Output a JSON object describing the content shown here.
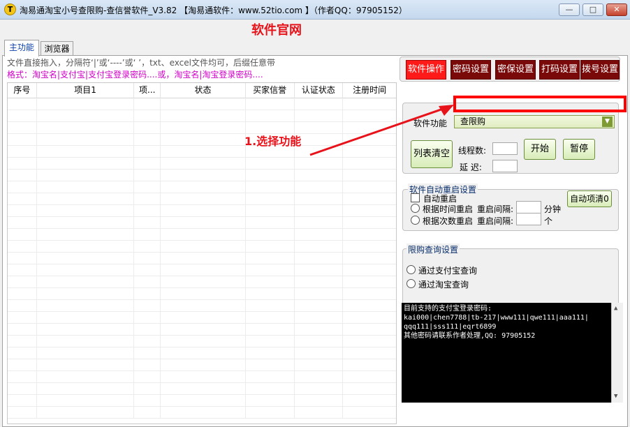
{
  "window": {
    "app_icon": "T",
    "title": "淘易通淘宝小号查限购-查信誉软件_V3.82 【淘易通软件：www.52tio.com 】（作者QQ：97905152）",
    "minimize": "—",
    "maximize": "□",
    "close": "✕"
  },
  "header": {
    "site_link": "软件官网"
  },
  "tabs": [
    {
      "label": "主功能",
      "active": true
    },
    {
      "label": "浏览器",
      "active": false
    }
  ],
  "hints": {
    "line1": "文件直接拖入，分隔符‘|’或‘----’或‘    ’，txt、excel文件均可，后缀任意带",
    "line2": "格式：淘宝名|支付宝|支付宝登录密码....或，淘宝名|淘宝登录密码...."
  },
  "table": {
    "columns": [
      "序号",
      "项目1",
      "项...",
      "状态",
      "买家信誉",
      "认证状态",
      "注册时间"
    ]
  },
  "toolbar": {
    "buttons": [
      {
        "label": "软件操作",
        "active": true
      },
      {
        "label": "密码设置",
        "active": false
      },
      {
        "label": "密保设置",
        "active": false
      },
      {
        "label": "打码设置",
        "active": false
      },
      {
        "label": "拨号设置",
        "active": false
      }
    ]
  },
  "function_panel": {
    "label": "软件功能",
    "selected": "查限购",
    "clear_button": "列表清空",
    "threads_label": "线程数:",
    "threads_value": "",
    "delay_label": "延  迟:",
    "delay_value": "",
    "start_button": "开始",
    "pause_button": "暂停"
  },
  "restart_group": {
    "title": "软件自动重启设置",
    "auto_restart": {
      "label": "自动重启",
      "checked": false
    },
    "by_time": {
      "label": "根据时间重启",
      "checked": false
    },
    "by_count": {
      "label": "根据次数重启",
      "checked": false
    },
    "interval_label_1": "重启间隔:",
    "interval_label_2": "重启间隔:",
    "unit_minutes": "分钟",
    "unit_times": "个",
    "auto_clear_button": "自动项清0"
  },
  "query_group": {
    "title": "限购查询设置",
    "options": [
      {
        "label": "通过支付宝查询",
        "selected": false
      },
      {
        "label": "通过淘宝查询",
        "selected": false
      }
    ]
  },
  "console": {
    "lines": [
      " 目前支持的支付宝登录密码:",
      "kai000|chen7788|tb-217|www111|qwe111|aaa111|",
      "qqq111|sss111|eqrt6899",
      "其他密码请联系作者处理,QQ: 97905152"
    ]
  },
  "annotation": {
    "text": "1.选择功能",
    "color": "#e8121a"
  },
  "colors": {
    "accent_red": "#ff1a1a",
    "dark_red": "#7a0a0a",
    "hint_magenta": "#d000c8"
  }
}
